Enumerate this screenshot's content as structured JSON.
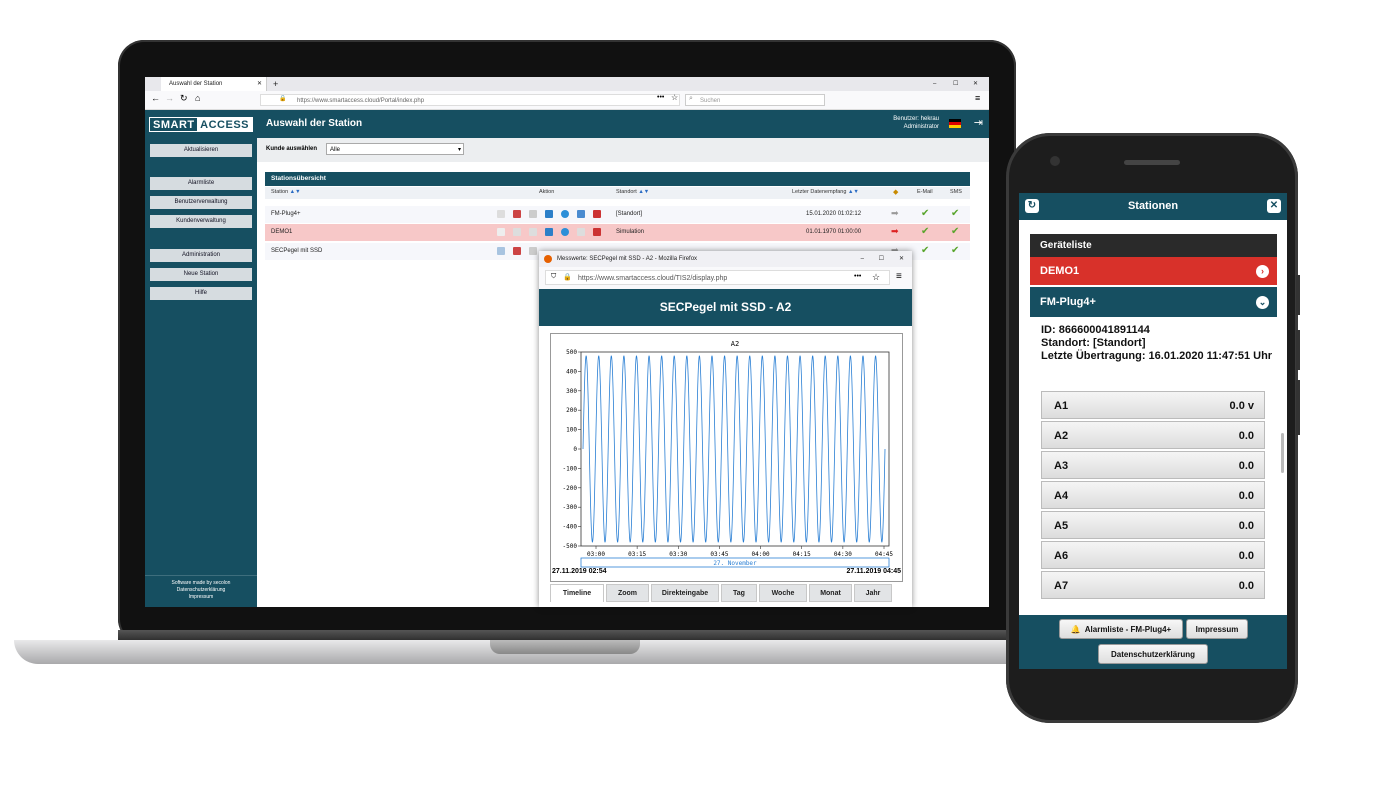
{
  "laptop": {
    "browser": {
      "tab_title": "Auswahl der Station",
      "url": "https://www.smartaccess.cloud/Portal/index.php",
      "search_placeholder": "Suchen"
    },
    "app": {
      "logo_smart": "SMART",
      "logo_access": "ACCESS",
      "page_title": "Auswahl der Station",
      "user_line1": "Benutzer: hekrau",
      "user_line2": "Administrator",
      "sidebar": {
        "refresh": "Aktualisieren",
        "group1": [
          "Alarmliste",
          "Benutzerverwaltung",
          "Kundenverwaltung"
        ],
        "group2": [
          "Administration",
          "Neue Station",
          "Hilfe"
        ],
        "footer": [
          "Software made by secolon",
          "Datenschutzerklärung",
          "Impressum"
        ]
      },
      "customer_label": "Kunde auswählen",
      "customer_value": "Alle",
      "table_title": "Stationsübersicht",
      "columns": {
        "station": "Station",
        "action": "Aktion",
        "location": "Standort",
        "last_reception": "Letzter Datenempfang",
        "email": "E-Mail",
        "sms": "SMS"
      },
      "rows": [
        {
          "station": "FM-Plug4+",
          "location": "[Standort]",
          "last": "15.01.2020 01:02:12"
        },
        {
          "station": "DEMO1",
          "location": "Simulation",
          "last": "01.01.1970 01:00:00"
        },
        {
          "station": "SECPegel mit SSD",
          "location": "",
          "last": ""
        }
      ],
      "colors": {
        "primary": "#164f61",
        "alarm_row": "#f7c8c8",
        "check": "#59a52c"
      }
    },
    "popup": {
      "window_title": "Messwerte: SECPegel mit SSD - A2 - Mozilla Firefox",
      "url": "https://www.smartaccess.cloud/TIS2/display.php",
      "header": "SECPegel mit SSD - A2",
      "range_start": "27.11.2019 02:54",
      "range_end": "27.11.2019 04:45",
      "tabs": [
        "Timeline",
        "Zoom",
        "Direkteingabe",
        "Tag",
        "Woche",
        "Monat",
        "Jahr"
      ],
      "active_tab": "Timeline"
    }
  },
  "chart_data": {
    "type": "line",
    "title": "A2",
    "xlabel": "27. November",
    "ylabel": "",
    "x_ticks": [
      "03:00",
      "03:15",
      "03:30",
      "03:45",
      "04:00",
      "04:15",
      "04:30",
      "04:45"
    ],
    "y_ticks": [
      500,
      400,
      300,
      200,
      100,
      0,
      -100,
      -200,
      -300,
      -400,
      -500
    ],
    "ylim": [
      -500,
      500
    ],
    "series": [
      {
        "pattern": "sine",
        "amplitude": 480,
        "cycles": 24,
        "color": "#2a7fd4"
      }
    ]
  },
  "phone": {
    "title": "Stationen",
    "list_header": "Geräteliste",
    "demo": "DEMO1",
    "fm": "FM-Plug4+",
    "info_id": "ID: 866600041891144",
    "info_location": "Standort: [Standort]",
    "info_last": "Letzte Übertragung: 16.01.2020 11:47:51 Uhr",
    "channels": [
      {
        "name": "A1",
        "value": "0.0 v"
      },
      {
        "name": "A2",
        "value": "0.0"
      },
      {
        "name": "A3",
        "value": "0.0"
      },
      {
        "name": "A4",
        "value": "0.0"
      },
      {
        "name": "A5",
        "value": "0.0"
      },
      {
        "name": "A6",
        "value": "0.0"
      },
      {
        "name": "A7",
        "value": "0.0"
      }
    ],
    "footer_alarm": "Alarmliste - FM-Plug4+",
    "footer_impressum": "Impressum",
    "footer_privacy": "Datenschutzerklärung"
  }
}
